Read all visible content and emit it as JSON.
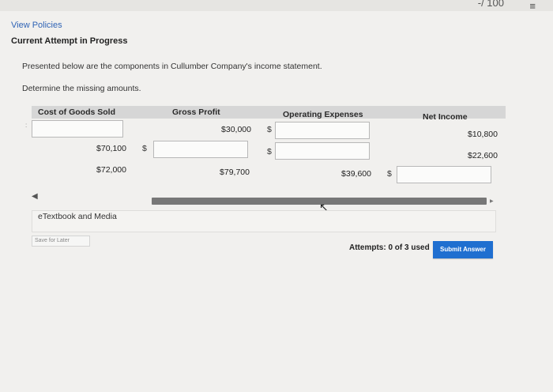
{
  "header": {
    "score": "-/ 100",
    "menu_icon": "list-icon",
    "view_policies": "View Policies",
    "attempt_status": "Current Attempt in Progress"
  },
  "question": {
    "text": "Presented below are the components in Cullumber Company's income statement.",
    "instruction": "Determine the missing amounts."
  },
  "table": {
    "headers": [
      "Cost of Goods Sold",
      "Gross Profit",
      "Operating Expenses",
      "Net Income"
    ],
    "rows": [
      {
        "cost_of_goods_sold": "",
        "gross_profit": "$30,000",
        "operating_expenses": "",
        "net_income": "$10,800"
      },
      {
        "cost_of_goods_sold": "$70,100",
        "gross_profit": "",
        "operating_expenses": "",
        "net_income": "$22,600"
      },
      {
        "cost_of_goods_sold": "$72,000",
        "gross_profit": "$79,700",
        "operating_expenses": "$39,600",
        "net_income": ""
      }
    ],
    "dollar_sign": "$"
  },
  "etextbook": "eTextbook and Media",
  "footer": {
    "save_for_later": "Save for Later",
    "attempts": "Attempts: 0 of 3 used",
    "submit": "Submit Answer"
  },
  "colors": {
    "accent": "#1f6fd0",
    "link": "#2f63b5"
  }
}
